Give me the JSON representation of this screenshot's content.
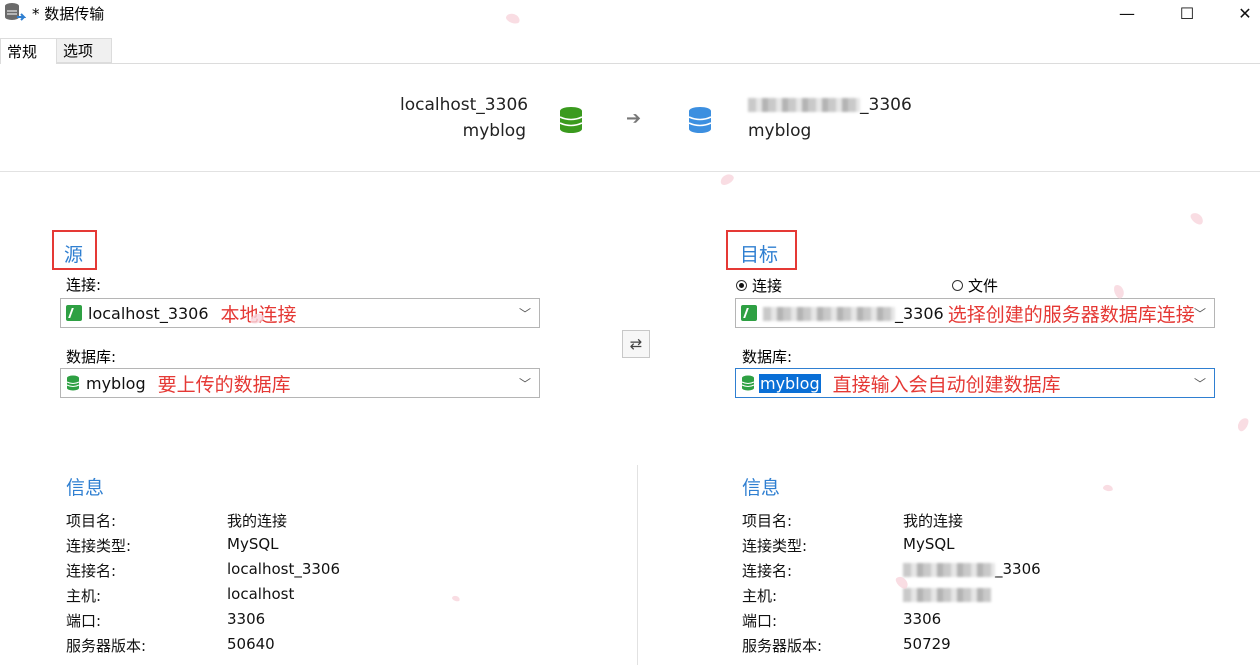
{
  "window": {
    "title": "* 数据传输",
    "minimize_glyph": "—",
    "maximize_glyph": "☐",
    "close_glyph": "✕"
  },
  "tabs": [
    {
      "label": "常规",
      "active": true
    },
    {
      "label": "选项",
      "active": false
    }
  ],
  "header": {
    "source_connection": "localhost_3306",
    "source_database": "myblog",
    "target_connection_suffix": "3306",
    "target_database": "myblog",
    "arrow": "➔",
    "source_icon_color": "#3a9a1e",
    "target_icon_color": "#3c8fe0"
  },
  "source": {
    "title": "源",
    "connection_label": "连接:",
    "connection_value": "localhost_3306",
    "connection_note": "本地连接",
    "database_label": "数据库:",
    "database_value": "myblog",
    "database_note": "要上传的数据库"
  },
  "swap_glyph": "⇄",
  "target": {
    "title": "目标",
    "radio_connection": "连接",
    "radio_file": "文件",
    "connection_value_suffix": "3306",
    "connection_note": "选择创建的服务器数据库连接",
    "database_label": "数据库:",
    "database_value": "myblog",
    "database_note": "直接输入会自动创建数据库"
  },
  "source_info": {
    "title": "信息",
    "rows": [
      {
        "key": "项目名:",
        "value": "我的连接"
      },
      {
        "key": "连接类型:",
        "value": "MySQL"
      },
      {
        "key": "连接名:",
        "value": "localhost_3306"
      },
      {
        "key": "主机:",
        "value": "localhost"
      },
      {
        "key": "端口:",
        "value": "3306"
      },
      {
        "key": "服务器版本:",
        "value": "50640"
      }
    ]
  },
  "target_info": {
    "title": "信息",
    "rows": [
      {
        "key": "项目名:",
        "value": "我的连接"
      },
      {
        "key": "连接类型:",
        "value": "MySQL"
      },
      {
        "key": "连接名:",
        "value": "_3306"
      },
      {
        "key": "主机:",
        "value": ""
      },
      {
        "key": "端口:",
        "value": "3306"
      },
      {
        "key": "服务器版本:",
        "value": "50729"
      }
    ]
  },
  "colors": {
    "accent": "#2f7fd1",
    "annotation_red": "#e53935",
    "selection_blue": "#0a6fd6"
  }
}
